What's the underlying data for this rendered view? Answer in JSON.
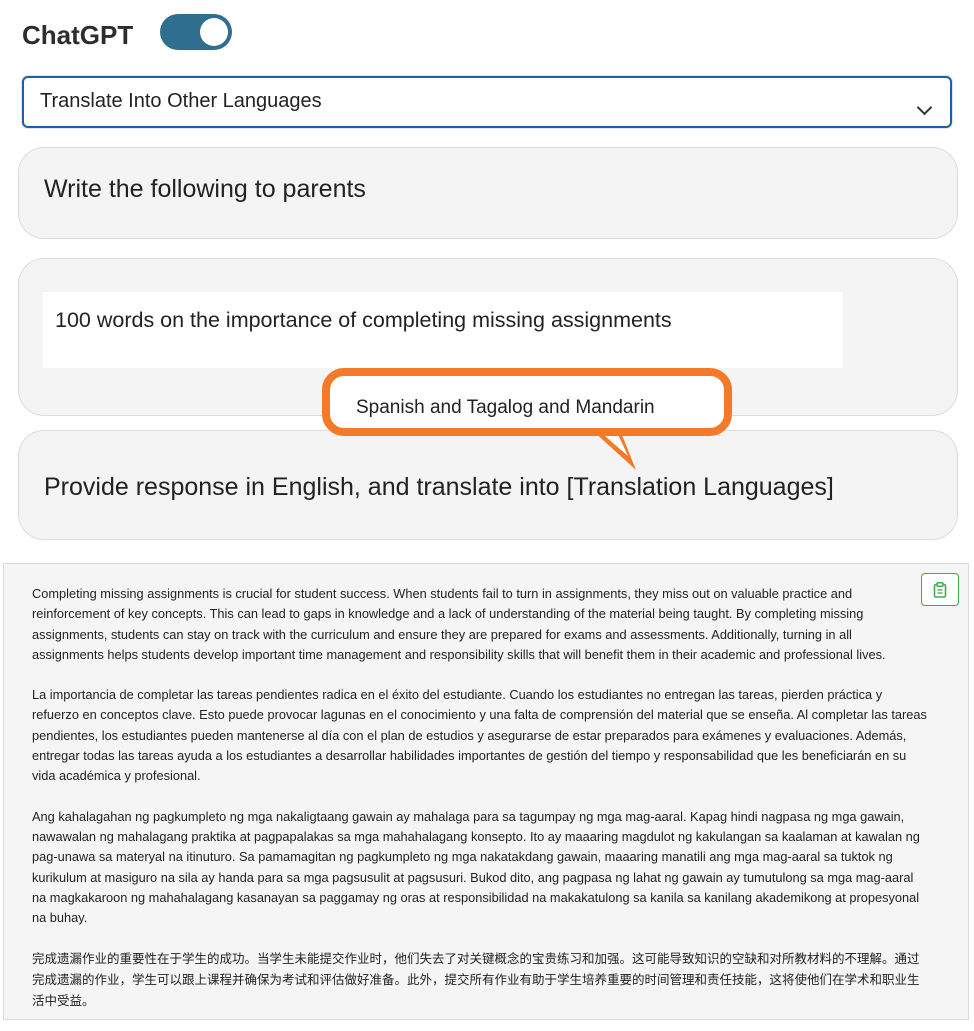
{
  "header": {
    "title": "ChatGPT",
    "toggle_on": true,
    "toggle_color": "#2f6e8e"
  },
  "template_select": {
    "selected": "Translate Into Other Languages",
    "icon": "chevron-down-icon"
  },
  "prompt_cards": [
    {
      "text": "Write the following to parents"
    },
    {
      "field_value": "100 words on the importance of completing missing assignments"
    },
    {
      "text": "Provide response in English, and translate into [Translation Languages]"
    }
  ],
  "callout": {
    "text": "Spanish and Tagalog and Mandarin",
    "border_color": "#f47a29"
  },
  "response": {
    "copy_icon": "clipboard-icon",
    "accent": "#3fae49",
    "paragraphs": [
      "Completing missing assignments is crucial for student success. When students fail to turn in assignments, they miss out on valuable practice and reinforcement of key concepts. This can lead to gaps in knowledge and a lack of understanding of the material being taught. By completing missing assignments, students can stay on track with the curriculum and ensure they are prepared for exams and assessments. Additionally, turning in all assignments helps students develop important time management and responsibility skills that will benefit them in their academic and professional lives.",
      "La importancia de completar las tareas pendientes radica en el éxito del estudiante. Cuando los estudiantes no entregan las tareas, pierden práctica y refuerzo en conceptos clave. Esto puede provocar lagunas en el conocimiento y una falta de comprensión del material que se enseña. Al completar las tareas pendientes, los estudiantes pueden mantenerse al día con el plan de estudios y asegurarse de estar preparados para exámenes y evaluaciones. Además, entregar todas las tareas ayuda a los estudiantes a desarrollar habilidades importantes de gestión del tiempo y responsabilidad que les beneficiarán en su vida académica y profesional.",
      "Ang kahalagahan ng pagkumpleto ng mga nakaligtaang gawain ay mahalaga para sa tagumpay ng mga mag-aaral. Kapag hindi nagpasa ng mga gawain, nawawalan ng mahalagang praktika at pagpapalakas sa mga mahahalagang konsepto. Ito ay maaaring magdulot ng kakulangan sa kaalaman at kawalan ng pag-unawa sa materyal na itinuturo. Sa pamamagitan ng pagkumpleto ng mga nakatakdang gawain, maaaring manatili ang mga mag-aaral sa tuktok ng kurikulum at masiguro na sila ay handa para sa mga pagsusulit at pagsusuri. Bukod dito, ang pagpasa ng lahat ng gawain ay tumutulong sa mga mag-aaral na magkakaroon ng mahahalagang kasanayan sa paggamay ng oras at responsibilidad na makakatulong sa kanila sa kanilang akademikong at propesyonal na buhay.",
      "完成遗漏作业的重要性在于学生的成功。当学生未能提交作业时，他们失去了对关键概念的宝贵练习和加强。这可能导致知识的空缺和对所教材料的不理解。通过完成遗漏的作业，学生可以跟上课程并确保为考试和评估做好准备。此外，提交所有作业有助于学生培养重要的时间管理和责任技能，这将使他们在学术和职业生活中受益。"
    ]
  }
}
